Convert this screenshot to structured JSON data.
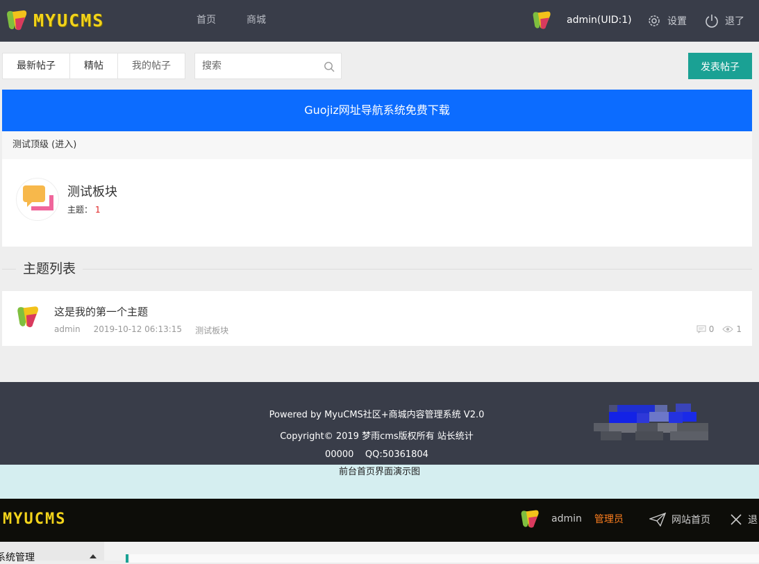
{
  "header": {
    "logo_text": "MYUCMS",
    "nav": [
      "首页",
      "商城"
    ],
    "user": "admin(UID:1)",
    "settings_label": "设置",
    "logout_label": "退了"
  },
  "toolbar": {
    "tabs": [
      "最新帖子",
      "精帖",
      "我的帖子"
    ],
    "search_placeholder": "搜索",
    "post_button": "发表帖子"
  },
  "banner": {
    "text": "Guojiz网址导航系统免费下载"
  },
  "forum": {
    "crumb": "测试顶级 (进入)",
    "board_name": "测试板块",
    "topic_label": "主题：",
    "topic_count": "1"
  },
  "topic_list": {
    "title": "主题列表",
    "items": [
      {
        "title": "这是我的第一个主题",
        "author": "admin",
        "time": "2019-10-12 06:13:15",
        "board": "测试板块",
        "comments": "0",
        "views": "1"
      }
    ]
  },
  "footer": {
    "line1": "Powered by MyuCMS社区+商城内容管理系统 V2.0",
    "line2": "Copyright© 2019 梦雨cms版权所有 站长统计",
    "line3": "00000    QQ:50361804"
  },
  "caption": "前台首页界面演示图",
  "admin": {
    "logo_text": "MYUCMS",
    "user": "admin",
    "role": "管理员",
    "home_label": "网站首页",
    "exit_label": "退",
    "side_title": "系统管理"
  },
  "colors": {
    "header_bg": "#393d49",
    "accent": "#1aa194",
    "banner": "#0c6cff",
    "count": "#e02020",
    "admin_role": "#ff7f1e"
  }
}
